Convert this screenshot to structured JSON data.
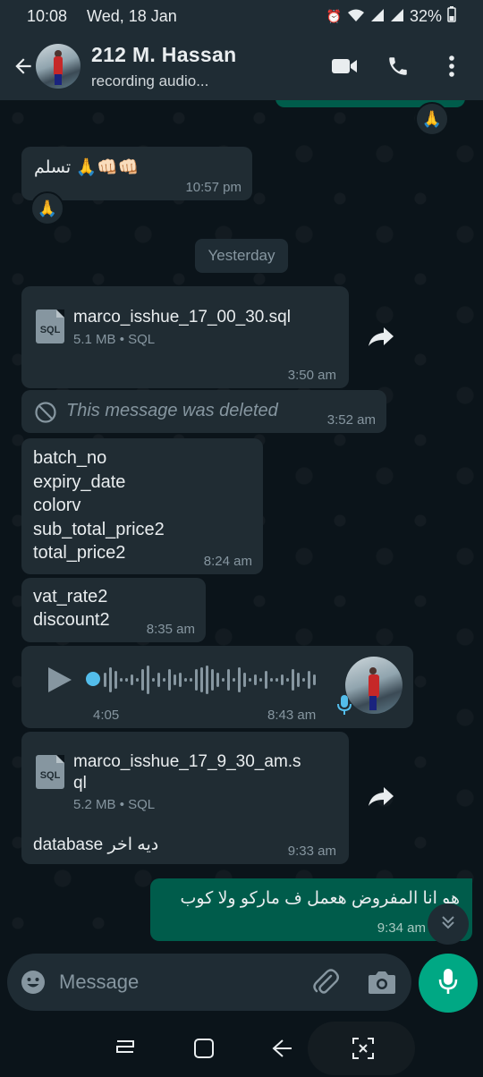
{
  "status_bar": {
    "time": "10:08",
    "date": "Wed, 18 Jan",
    "battery": "32%"
  },
  "header": {
    "contact_name": "212 M. Hassan",
    "status": "recording audio..."
  },
  "colors": {
    "app_bar": "#1f2c34",
    "incoming_bubble": "#202c33",
    "outgoing_bubble": "#005c4b",
    "accent": "#00a884",
    "timestamp": "#8696a0",
    "audio_dot": "#53bdeb"
  },
  "messages": [
    {
      "direction": "out",
      "partial": true,
      "reaction": "🙏"
    },
    {
      "direction": "in",
      "type": "text",
      "text": "تسلم 🙏👊🏻👊🏻",
      "time": "10:57 pm",
      "reaction": "🙏"
    },
    {
      "type": "date_chip",
      "text": "Yesterday"
    },
    {
      "direction": "in",
      "type": "document",
      "icon_label": "SQL",
      "file_name": "marco_isshue_17_00_30.sql",
      "file_size": "5.1 MB",
      "file_type": "SQL",
      "time": "3:50 am"
    },
    {
      "direction": "in",
      "type": "deleted",
      "text": "This message was deleted",
      "time": "3:52 am"
    },
    {
      "direction": "in",
      "type": "text",
      "lines": [
        "batch_no",
        "expiry_date",
        "colorv",
        "sub_total_price2",
        "total_price2"
      ],
      "time": "8:24 am"
    },
    {
      "direction": "in",
      "type": "text",
      "lines": [
        "vat_rate2",
        "discount2"
      ],
      "time": "8:35 am"
    },
    {
      "direction": "in",
      "type": "voice",
      "duration": "4:05",
      "time": "8:43 am"
    },
    {
      "direction": "in",
      "type": "document",
      "icon_label": "SQL",
      "file_name_line1": "marco_isshue_17_9_30_am.s",
      "file_name_line2": "ql",
      "file_size": "5.2 MB",
      "file_type": "SQL",
      "caption": "database ديه اخر",
      "time": "9:33 am"
    },
    {
      "direction": "out",
      "type": "text",
      "text": "هو انا المفروض هعمل ف ماركو ولا كوب",
      "time": "9:34 am"
    }
  ],
  "input": {
    "placeholder": "Message"
  }
}
